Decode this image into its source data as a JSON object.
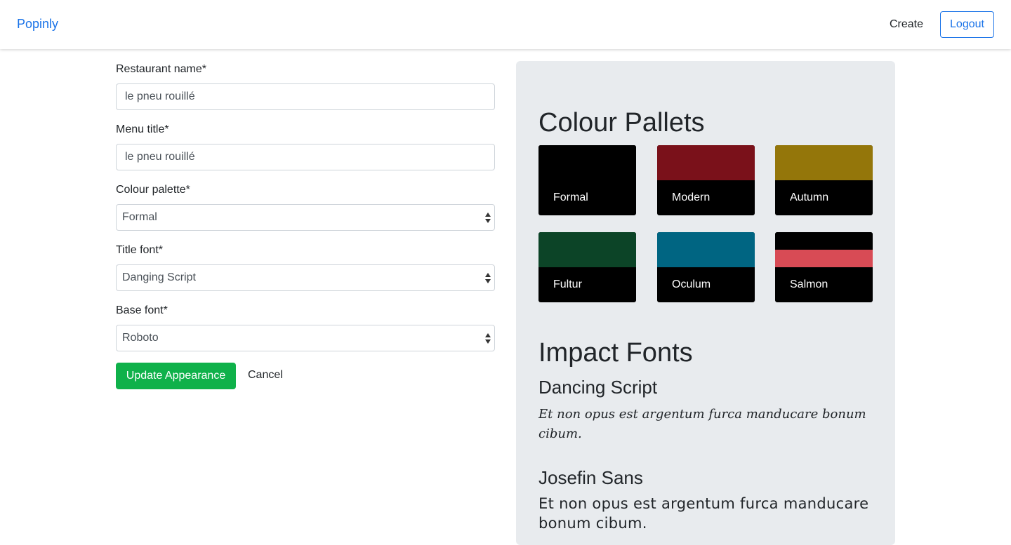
{
  "nav": {
    "brand": "Popinly",
    "create": "Create",
    "logout": "Logout"
  },
  "form": {
    "restaurant_name_label": "Restaurant name*",
    "restaurant_name_value": "le pneu rouillé",
    "menu_title_label": "Menu title*",
    "menu_title_value": "le pneu rouillé",
    "colour_palette_label": "Colour palette*",
    "colour_palette_value": "Formal",
    "title_font_label": "Title font*",
    "title_font_value": "Danging Script",
    "base_font_label": "Base font*",
    "base_font_value": "Roboto",
    "update_button": "Update Appearance",
    "cancel_button": "Cancel"
  },
  "preview": {
    "pallets_heading": "Colour Pallets",
    "palettes": [
      {
        "name": "Formal",
        "band1": "#000000",
        "band2": "#000000"
      },
      {
        "name": "Modern",
        "band1": "#7a111a",
        "band2": "#7a111a"
      },
      {
        "name": "Autumn",
        "band1": "#94760a",
        "band2": "#94760a"
      },
      {
        "name": "Fultur",
        "band1": "#0c4427",
        "band2": "#0c4427"
      },
      {
        "name": "Oculum",
        "band1": "#006582",
        "band2": "#006582"
      },
      {
        "name": "Salmon",
        "band1": "#000000",
        "band2": "#d84b55"
      }
    ],
    "fonts_heading": "Impact Fonts",
    "fonts": [
      {
        "name": "Dancing Script",
        "sample": "Et non opus est argentum furca manducare bonum cibum."
      },
      {
        "name": "Josefin Sans",
        "sample": "Et non opus est argentum furca manducare bonum cibum."
      }
    ]
  }
}
